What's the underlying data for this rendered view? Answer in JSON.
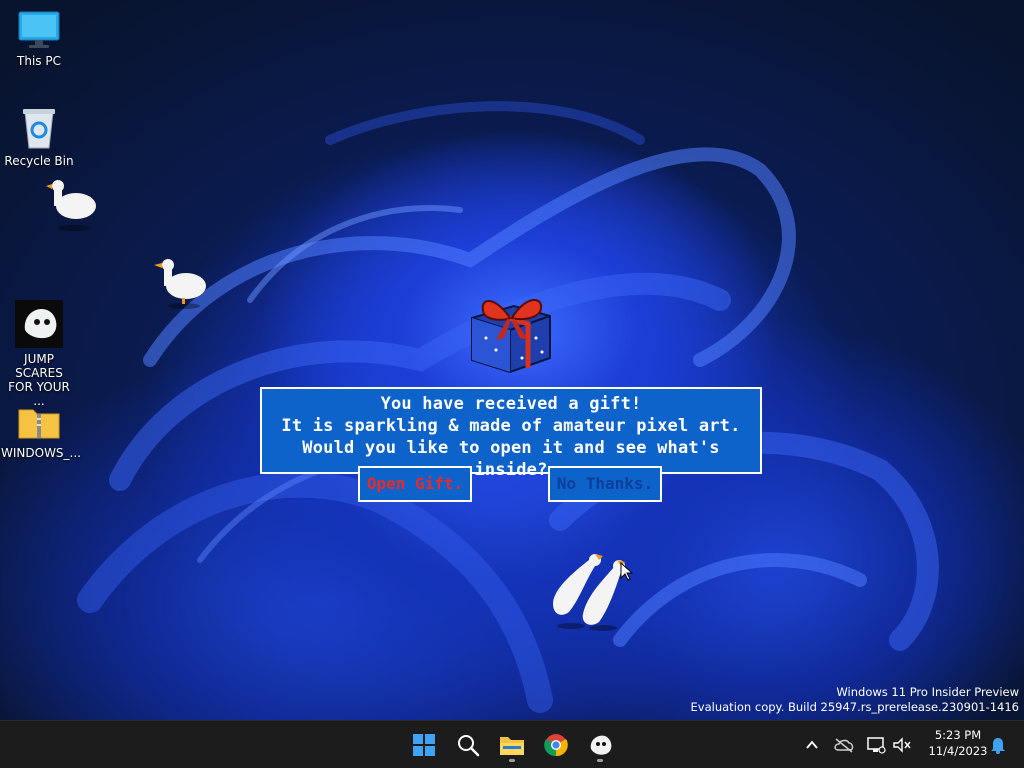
{
  "desktop": {
    "icons": [
      {
        "label": "This PC",
        "icon": "monitor-icon"
      },
      {
        "label": "Recycle Bin",
        "icon": "recycle-bin-icon"
      },
      {
        "label": "JUMP SCARES FOR YOUR ...",
        "icon": "ghost-app-icon"
      },
      {
        "label": "WINDOWS_...",
        "icon": "zip-folder-icon"
      }
    ]
  },
  "gift_dialog": {
    "line1": "You have received a gift!",
    "line2": "It is sparkling & made of amateur pixel art.",
    "line3": "Would you like to open it and see what's inside?",
    "open_label": "Open Gift.",
    "decline_label": "No Thanks."
  },
  "watermark": {
    "line1": "Windows 11 Pro Insider Preview",
    "line2": "Evaluation copy. Build 25947.rs_prerelease.230901-1416"
  },
  "taskbar": {
    "apps": [
      "start-icon",
      "search-icon",
      "file-explorer-icon",
      "chrome-icon",
      "ghost-app-icon"
    ],
    "clock_time": "5:23 PM",
    "clock_date": "11/4/2023"
  },
  "colors": {
    "dialog_bg": "#0d63c9",
    "open_text": "#e62b2b",
    "decline_text": "#0a3f9e",
    "taskbar_bg": "#1c1c1c"
  }
}
